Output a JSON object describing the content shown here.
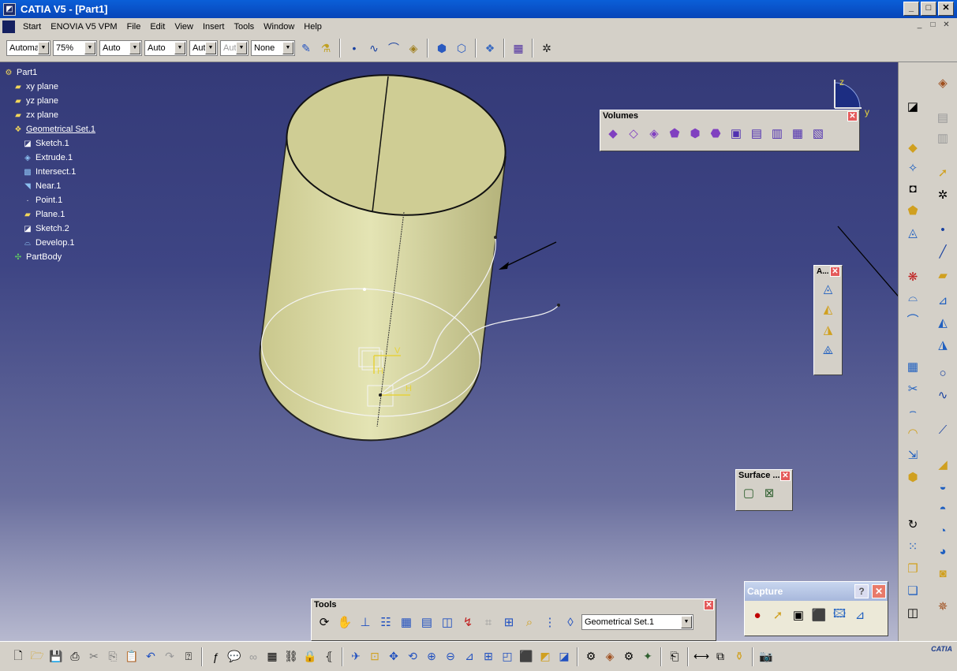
{
  "window": {
    "title": "CATIA V5 - [Part1]",
    "btn_min": "_",
    "btn_max": "□",
    "btn_close": "✕"
  },
  "menu": {
    "items": [
      {
        "label": "Start",
        "name": "menu-start"
      },
      {
        "label": "ENOVIA V5 VPM",
        "name": "menu-enovia"
      },
      {
        "label": "File",
        "name": "menu-file"
      },
      {
        "label": "Edit",
        "name": "menu-edit"
      },
      {
        "label": "View",
        "name": "menu-view"
      },
      {
        "label": "Insert",
        "name": "menu-insert"
      },
      {
        "label": "Tools",
        "name": "menu-tools"
      },
      {
        "label": "Window",
        "name": "menu-window"
      },
      {
        "label": "Help",
        "name": "menu-help"
      }
    ],
    "mdi_min": "_",
    "mdi_max": "□",
    "mdi_close": "✕"
  },
  "toolbar": {
    "combo1": "Automa",
    "combo2": "75%",
    "combo3": "Auto",
    "combo4": "Auto",
    "combo5": "Aut",
    "combo6": "Aut",
    "combo7": "None"
  },
  "tree": {
    "items": [
      {
        "label": "Part1",
        "icon": "part-icon",
        "depth": 0
      },
      {
        "label": "xy plane",
        "icon": "plane-icon",
        "depth": 1
      },
      {
        "label": "yz plane",
        "icon": "plane-icon",
        "depth": 1
      },
      {
        "label": "zx plane",
        "icon": "plane-icon",
        "depth": 1
      },
      {
        "label": "Geometrical Set.1",
        "icon": "geometrical-set-icon",
        "depth": 1
      },
      {
        "label": "Sketch.1",
        "icon": "sketch-icon",
        "depth": 2
      },
      {
        "label": "Extrude.1",
        "icon": "extrude-icon",
        "depth": 2
      },
      {
        "label": "Intersect.1",
        "icon": "intersect-icon",
        "depth": 2
      },
      {
        "label": "Near.1",
        "icon": "near-icon",
        "depth": 2
      },
      {
        "label": "Point.1",
        "icon": "point-icon",
        "depth": 2
      },
      {
        "label": "Plane.1",
        "icon": "plane-icon",
        "depth": 2
      },
      {
        "label": "Sketch.2",
        "icon": "sketch-icon",
        "depth": 2
      },
      {
        "label": "Develop.1",
        "icon": "develop-icon",
        "depth": 2
      },
      {
        "label": "PartBody",
        "icon": "partbody-icon",
        "depth": 1
      }
    ]
  },
  "compass": {
    "z_label": "z",
    "y_label": "y"
  },
  "sketch_labels": {
    "v": "V",
    "h1": "H",
    "h2": "H"
  },
  "panels": {
    "volumes": {
      "title": "Volumes",
      "close": "✕"
    },
    "a": {
      "title": "A...",
      "close": "✕"
    },
    "surface": {
      "title": "Surface ...",
      "close": "✕"
    },
    "tools": {
      "title": "Tools",
      "close": "✕",
      "geom_set_value": "Geometrical Set.1"
    },
    "capture": {
      "title": "Capture",
      "help": "?",
      "close": "✕"
    }
  },
  "status": {
    "catia_logo": "CATIA"
  }
}
